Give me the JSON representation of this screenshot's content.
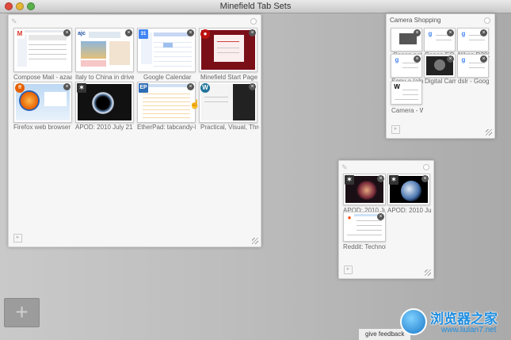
{
  "window": {
    "title": "Minefield Tab Sets"
  },
  "groups": {
    "main": {
      "title": "",
      "tabs": [
        {
          "label": "Compose Mail - azaag",
          "favicon": "M"
        },
        {
          "label": "Italy to China in driver",
          "favicon": "ajc"
        },
        {
          "label": "Google Calendar",
          "favicon": "31"
        },
        {
          "label": "Minefield Start Page",
          "favicon": "fire"
        },
        {
          "label": "Firefox web browser |",
          "favicon": "ff"
        },
        {
          "label": "APOD: 2010 July 21 -",
          "favicon": "apod"
        },
        {
          "label": "EtherPad: tabcandy-bi",
          "favicon": "EP"
        },
        {
          "label": "Practical, Visual, Three",
          "favicon": "W"
        }
      ]
    },
    "camera": {
      "title": "Camera Shopping",
      "tabs": [
        {
          "label": "Canon not a",
          "favicon": "g"
        },
        {
          "label": "Canon EOS",
          "favicon": "g"
        },
        {
          "label": "Nikon D300",
          "favicon": "g"
        },
        {
          "label": "Sony a (alpl",
          "favicon": "g"
        },
        {
          "label": "Digital Cam",
          "favicon": "dp"
        },
        {
          "label": "dslr - Googl",
          "favicon": "g"
        },
        {
          "label": "Camera - W",
          "favicon": "W"
        }
      ]
    },
    "space": {
      "title": "",
      "tabs": [
        {
          "label": "APOD: 2010 Jul",
          "favicon": "apod"
        },
        {
          "label": "APOD: 2010 Jul",
          "favicon": "apod"
        },
        {
          "label": "Reddit: Technol",
          "favicon": "reddit"
        }
      ]
    }
  },
  "controls": {
    "add_tab_symbol": "+",
    "feedback_label": "give feedback"
  },
  "watermark": {
    "name_cn": "浏览器之家",
    "url": "www.liulan7.net"
  },
  "colors": {
    "gmail_red": "#d93025",
    "firefox_orange": "#e66000",
    "google_blue": "#4285f4",
    "brand_blue": "#1f8ee0"
  }
}
